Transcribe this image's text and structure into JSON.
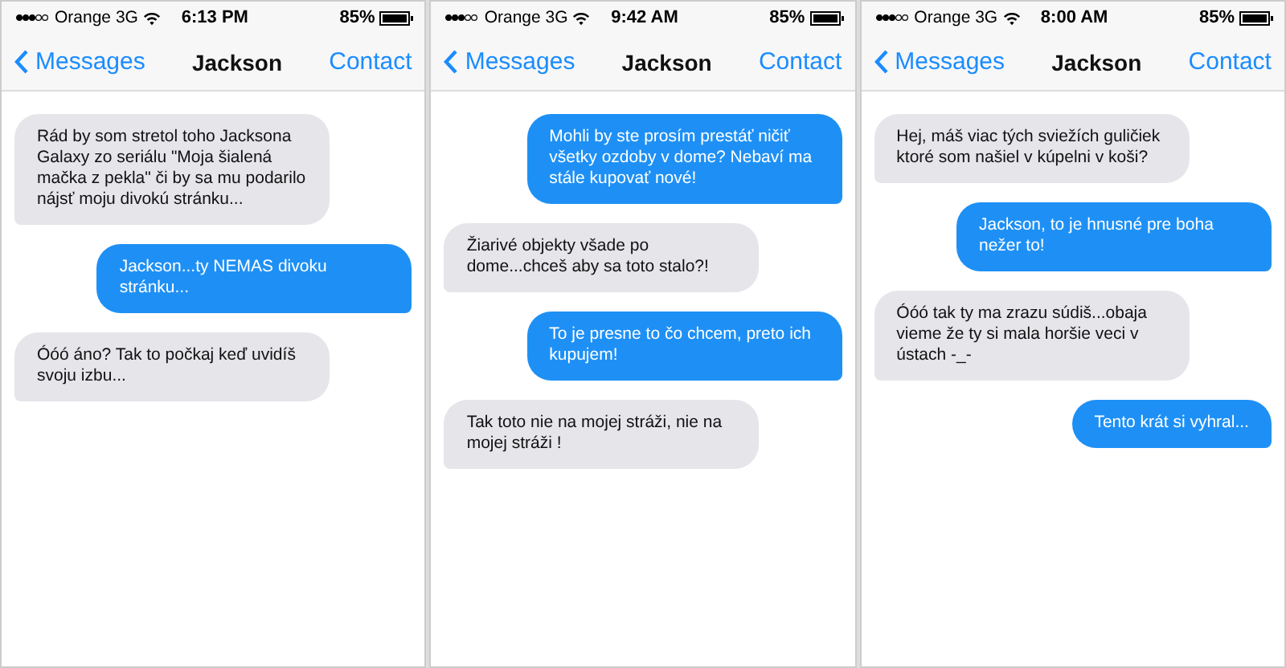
{
  "screens": [
    {
      "status_bar": {
        "carrier": "Orange 3G",
        "time": "6:13 PM",
        "battery": "85%"
      },
      "nav_bar": {
        "back": "Messages",
        "title": "Jackson",
        "action": "Contact"
      },
      "messages": [
        {
          "kind": "them",
          "text": "Rád by som stretol toho Jacksona Galaxy zo seriálu \"Moja šialená mačka z pekla\" či by sa mu podarilo nájsť moju divokú stránku..."
        },
        {
          "kind": "me",
          "text": "Jackson...ty NEMAS divoku stránku..."
        },
        {
          "kind": "them",
          "text": "Óóó áno? Tak to počkaj keď uvidíš svoju izbu..."
        }
      ]
    },
    {
      "status_bar": {
        "carrier": "Orange 3G",
        "time": "9:42 AM",
        "battery": "85%"
      },
      "nav_bar": {
        "back": "Messages",
        "title": "Jackson",
        "action": "Contact"
      },
      "messages": [
        {
          "kind": "me",
          "text": "Mohli by ste prosím prestáť ničiť všetky ozdoby v dome? Nebaví ma stále kupovať nové!"
        },
        {
          "kind": "them",
          "text": "Žiarivé objekty všade po dome...chceš aby sa toto stalo?!"
        },
        {
          "kind": "me",
          "text": "To je presne to čo chcem, preto ich kupujem!"
        },
        {
          "kind": "them",
          "text": "Tak toto nie na mojej stráži, nie na mojej stráži !"
        }
      ]
    },
    {
      "status_bar": {
        "carrier": "Orange 3G",
        "time": "8:00 AM",
        "battery": "85%"
      },
      "nav_bar": {
        "back": "Messages",
        "title": "Jackson",
        "action": "Contact"
      },
      "messages": [
        {
          "kind": "them",
          "text": "Hej, máš viac tých sviežích guličiek ktoré som našiel v kúpelni v koši?"
        },
        {
          "kind": "me",
          "text": "Jackson, to je hnusné pre boha nežer to!"
        },
        {
          "kind": "them",
          "text": "Óóó tak ty ma zrazu súdiš...obaja vieme že ty si mala horšie veci v ústach -_-"
        },
        {
          "kind": "me",
          "text": "Tento krát si vyhral..."
        }
      ]
    }
  ]
}
